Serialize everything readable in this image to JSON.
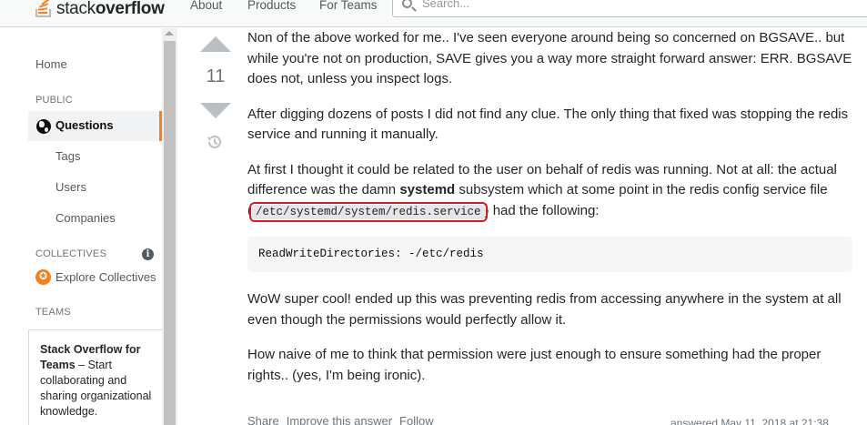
{
  "header": {
    "logo_text_light": "stack",
    "logo_text_bold": "overflow",
    "nav": [
      "About",
      "Products",
      "For Teams"
    ],
    "search_placeholder": "Search..."
  },
  "sidebar": {
    "home": "Home",
    "public_heading": "PUBLIC",
    "questions": "Questions",
    "tags": "Tags",
    "users": "Users",
    "companies": "Companies",
    "collectives_heading": "COLLECTIVES",
    "explore_collectives": "Explore Collectives",
    "teams_heading": "TEAMS",
    "teams_title": "Stack Overflow for Teams",
    "teams_text": " – Start collaborating and sharing organizational knowledge."
  },
  "vote": {
    "count": "11"
  },
  "post": {
    "p1": "Non of the above worked for me.. I've seen everyone around being so concerned on BGSAVE.. but while you're not on production, SAVE gives you a way more straight forward answer: ERR. BGSAVE does not, unless you inspect logs.",
    "p2": "After digging dozens of posts I did not find any clue. The only thing that fixed was stopping the redis service and running it manually.",
    "p3_before": "At first I thought it could be related to the user on behalf of redis was running. Not at all: the actual difference was the damn ",
    "p3_bold": "systemd",
    "p3_middle": " subsystem which at some point in the redis config service file (",
    "p3_code": "/etc/systemd/system/redis.service",
    "p3_after": ") had the following:",
    "code_block": "ReadWriteDirectories: -/etc/redis",
    "p4": "WoW super cool! ended up this was preventing redis from accessing anywhere in the system at all even though the permissions would perfectly allow it.",
    "p5": "How naive of me to think that permission were just enough to ensure something had the proper rights.. (yes, I'm being ironic).",
    "actions": [
      "Share",
      "Improve this answer",
      "Follow"
    ],
    "answered": "answered May 11, 2018 at 21:38"
  }
}
